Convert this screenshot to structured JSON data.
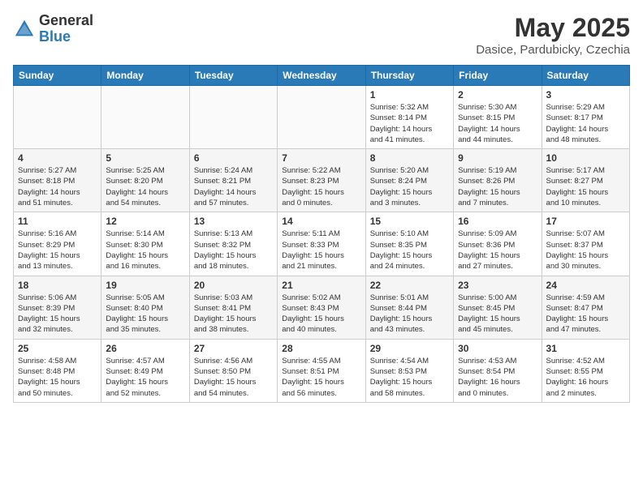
{
  "header": {
    "logo_line1": "General",
    "logo_line2": "Blue",
    "title": "May 2025",
    "location": "Dasice, Pardubicky, Czechia"
  },
  "days_of_week": [
    "Sunday",
    "Monday",
    "Tuesday",
    "Wednesday",
    "Thursday",
    "Friday",
    "Saturday"
  ],
  "weeks": [
    [
      {
        "day": "",
        "info": ""
      },
      {
        "day": "",
        "info": ""
      },
      {
        "day": "",
        "info": ""
      },
      {
        "day": "",
        "info": ""
      },
      {
        "day": "1",
        "info": "Sunrise: 5:32 AM\nSunset: 8:14 PM\nDaylight: 14 hours\nand 41 minutes."
      },
      {
        "day": "2",
        "info": "Sunrise: 5:30 AM\nSunset: 8:15 PM\nDaylight: 14 hours\nand 44 minutes."
      },
      {
        "day": "3",
        "info": "Sunrise: 5:29 AM\nSunset: 8:17 PM\nDaylight: 14 hours\nand 48 minutes."
      }
    ],
    [
      {
        "day": "4",
        "info": "Sunrise: 5:27 AM\nSunset: 8:18 PM\nDaylight: 14 hours\nand 51 minutes."
      },
      {
        "day": "5",
        "info": "Sunrise: 5:25 AM\nSunset: 8:20 PM\nDaylight: 14 hours\nand 54 minutes."
      },
      {
        "day": "6",
        "info": "Sunrise: 5:24 AM\nSunset: 8:21 PM\nDaylight: 14 hours\nand 57 minutes."
      },
      {
        "day": "7",
        "info": "Sunrise: 5:22 AM\nSunset: 8:23 PM\nDaylight: 15 hours\nand 0 minutes."
      },
      {
        "day": "8",
        "info": "Sunrise: 5:20 AM\nSunset: 8:24 PM\nDaylight: 15 hours\nand 3 minutes."
      },
      {
        "day": "9",
        "info": "Sunrise: 5:19 AM\nSunset: 8:26 PM\nDaylight: 15 hours\nand 7 minutes."
      },
      {
        "day": "10",
        "info": "Sunrise: 5:17 AM\nSunset: 8:27 PM\nDaylight: 15 hours\nand 10 minutes."
      }
    ],
    [
      {
        "day": "11",
        "info": "Sunrise: 5:16 AM\nSunset: 8:29 PM\nDaylight: 15 hours\nand 13 minutes."
      },
      {
        "day": "12",
        "info": "Sunrise: 5:14 AM\nSunset: 8:30 PM\nDaylight: 15 hours\nand 16 minutes."
      },
      {
        "day": "13",
        "info": "Sunrise: 5:13 AM\nSunset: 8:32 PM\nDaylight: 15 hours\nand 18 minutes."
      },
      {
        "day": "14",
        "info": "Sunrise: 5:11 AM\nSunset: 8:33 PM\nDaylight: 15 hours\nand 21 minutes."
      },
      {
        "day": "15",
        "info": "Sunrise: 5:10 AM\nSunset: 8:35 PM\nDaylight: 15 hours\nand 24 minutes."
      },
      {
        "day": "16",
        "info": "Sunrise: 5:09 AM\nSunset: 8:36 PM\nDaylight: 15 hours\nand 27 minutes."
      },
      {
        "day": "17",
        "info": "Sunrise: 5:07 AM\nSunset: 8:37 PM\nDaylight: 15 hours\nand 30 minutes."
      }
    ],
    [
      {
        "day": "18",
        "info": "Sunrise: 5:06 AM\nSunset: 8:39 PM\nDaylight: 15 hours\nand 32 minutes."
      },
      {
        "day": "19",
        "info": "Sunrise: 5:05 AM\nSunset: 8:40 PM\nDaylight: 15 hours\nand 35 minutes."
      },
      {
        "day": "20",
        "info": "Sunrise: 5:03 AM\nSunset: 8:41 PM\nDaylight: 15 hours\nand 38 minutes."
      },
      {
        "day": "21",
        "info": "Sunrise: 5:02 AM\nSunset: 8:43 PM\nDaylight: 15 hours\nand 40 minutes."
      },
      {
        "day": "22",
        "info": "Sunrise: 5:01 AM\nSunset: 8:44 PM\nDaylight: 15 hours\nand 43 minutes."
      },
      {
        "day": "23",
        "info": "Sunrise: 5:00 AM\nSunset: 8:45 PM\nDaylight: 15 hours\nand 45 minutes."
      },
      {
        "day": "24",
        "info": "Sunrise: 4:59 AM\nSunset: 8:47 PM\nDaylight: 15 hours\nand 47 minutes."
      }
    ],
    [
      {
        "day": "25",
        "info": "Sunrise: 4:58 AM\nSunset: 8:48 PM\nDaylight: 15 hours\nand 50 minutes."
      },
      {
        "day": "26",
        "info": "Sunrise: 4:57 AM\nSunset: 8:49 PM\nDaylight: 15 hours\nand 52 minutes."
      },
      {
        "day": "27",
        "info": "Sunrise: 4:56 AM\nSunset: 8:50 PM\nDaylight: 15 hours\nand 54 minutes."
      },
      {
        "day": "28",
        "info": "Sunrise: 4:55 AM\nSunset: 8:51 PM\nDaylight: 15 hours\nand 56 minutes."
      },
      {
        "day": "29",
        "info": "Sunrise: 4:54 AM\nSunset: 8:53 PM\nDaylight: 15 hours\nand 58 minutes."
      },
      {
        "day": "30",
        "info": "Sunrise: 4:53 AM\nSunset: 8:54 PM\nDaylight: 16 hours\nand 0 minutes."
      },
      {
        "day": "31",
        "info": "Sunrise: 4:52 AM\nSunset: 8:55 PM\nDaylight: 16 hours\nand 2 minutes."
      }
    ]
  ]
}
